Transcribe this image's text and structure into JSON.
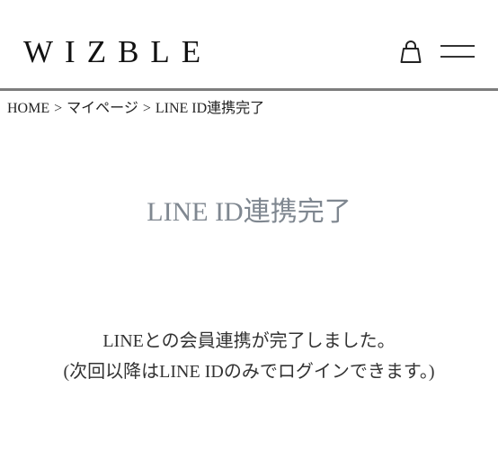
{
  "header": {
    "logo": "WIZBLE",
    "cart_icon": "shopping-bag-icon",
    "menu_icon": "hamburger-menu-icon"
  },
  "breadcrumb": {
    "items": [
      "HOME",
      "マイページ",
      "LINE ID連携完了"
    ],
    "separator": ">"
  },
  "main": {
    "title": "LINE ID連携完了",
    "message_line1": "LINEとの会員連携が完了しました。",
    "message_line2": "(次回以降はLINE IDのみでログインできます。)"
  },
  "colors": {
    "title": "#7f8790",
    "divider": "#7d7d7d",
    "text": "#333333"
  }
}
